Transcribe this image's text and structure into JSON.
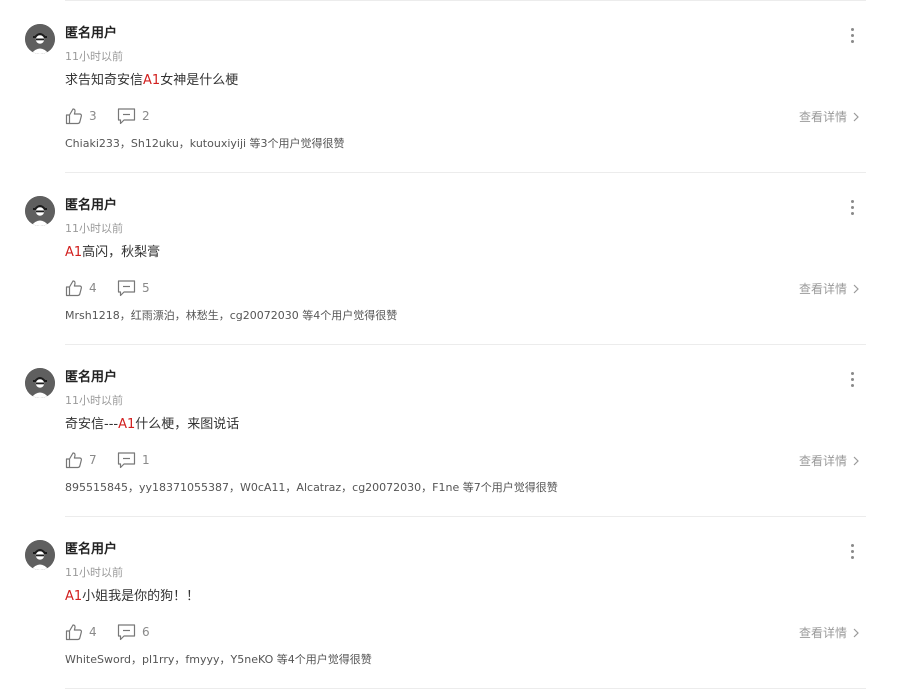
{
  "comments": [
    {
      "username": "匿名用户",
      "time": "11小时以前",
      "content_pre": "求告知奇安信",
      "content_hl": "A1",
      "content_post": "女神是什么梗",
      "likes": "3",
      "replies": "2",
      "detail_label": "查看详情",
      "likers": "Chiaki233，Sh12uku，kutouxiyiji 等3个用户觉得很赞"
    },
    {
      "username": "匿名用户",
      "time": "11小时以前",
      "content_pre": "",
      "content_hl": "A1",
      "content_post": "高闪，秋梨膏",
      "likes": "4",
      "replies": "5",
      "detail_label": "查看详情",
      "likers": "Mrsh1218，红雨漂泊，林愁生，cg20072030 等4个用户觉得很赞"
    },
    {
      "username": "匿名用户",
      "time": "11小时以前",
      "content_pre": "奇安信---",
      "content_hl": "A1",
      "content_post": "什么梗，来图说话",
      "likes": "7",
      "replies": "1",
      "detail_label": "查看详情",
      "likers": "895515845，yy18371055387，W0cA11，Alcatraz，cg20072030，F1ne 等7个用户觉得很赞"
    },
    {
      "username": "匿名用户",
      "time": "11小时以前",
      "content_pre": "",
      "content_hl": "A1",
      "content_post": "小姐我是你的狗！！",
      "likes": "4",
      "replies": "6",
      "detail_label": "查看详情",
      "likers": "WhiteSword，pl1rry，fmyyy，Y5neKO 等4个用户觉得很赞"
    }
  ],
  "icons": {
    "avatar": "anonymous-user-icon",
    "more": "more-vertical-icon",
    "like": "thumbs-up-icon",
    "reply": "comment-icon",
    "detail": "chevron-right-icon"
  },
  "colors": {
    "highlight": "#d2201f",
    "muted": "#9a9a9a",
    "divider": "#ececec"
  }
}
